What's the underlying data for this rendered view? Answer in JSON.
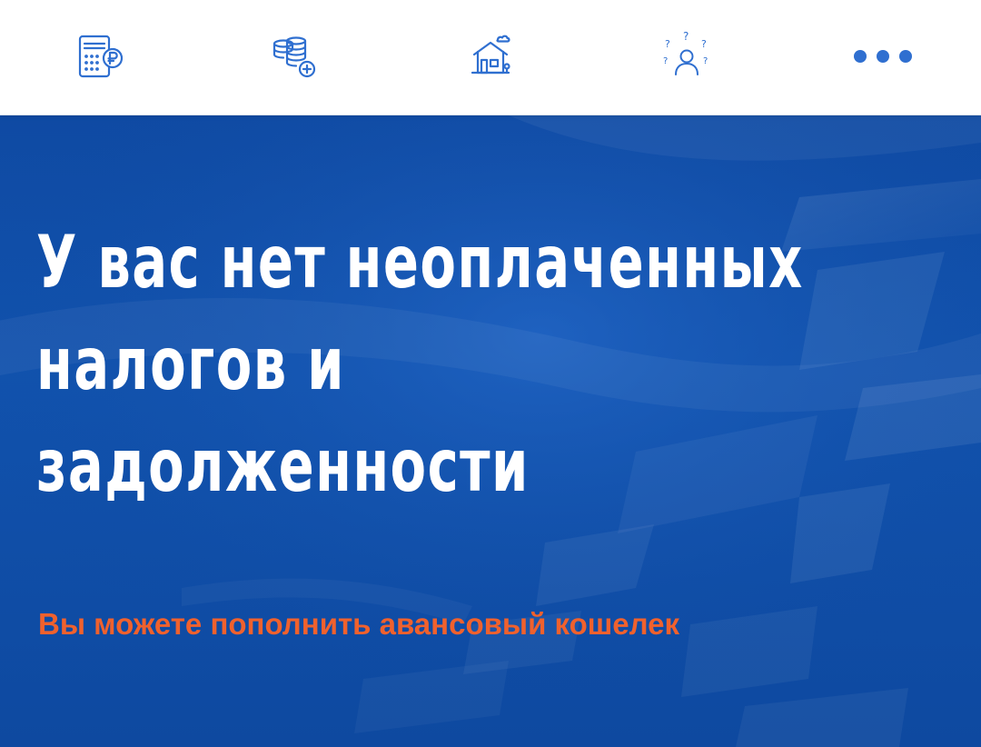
{
  "topbar": {
    "icons": [
      {
        "name": "calculator-ruble-icon"
      },
      {
        "name": "coins-plus-icon"
      },
      {
        "name": "house-icon"
      },
      {
        "name": "question-person-icon"
      },
      {
        "name": "more-dots-icon"
      }
    ],
    "icon_color": "#2f6fd0"
  },
  "hero": {
    "title_line1": "У вас нет неоплаченных",
    "title_line2": "налогов и",
    "title_line3": "задолженности",
    "subtitle": "Вы можете пополнить авансовый кошелек",
    "background_color": "#1152ad",
    "subtitle_color": "#f0612d"
  }
}
